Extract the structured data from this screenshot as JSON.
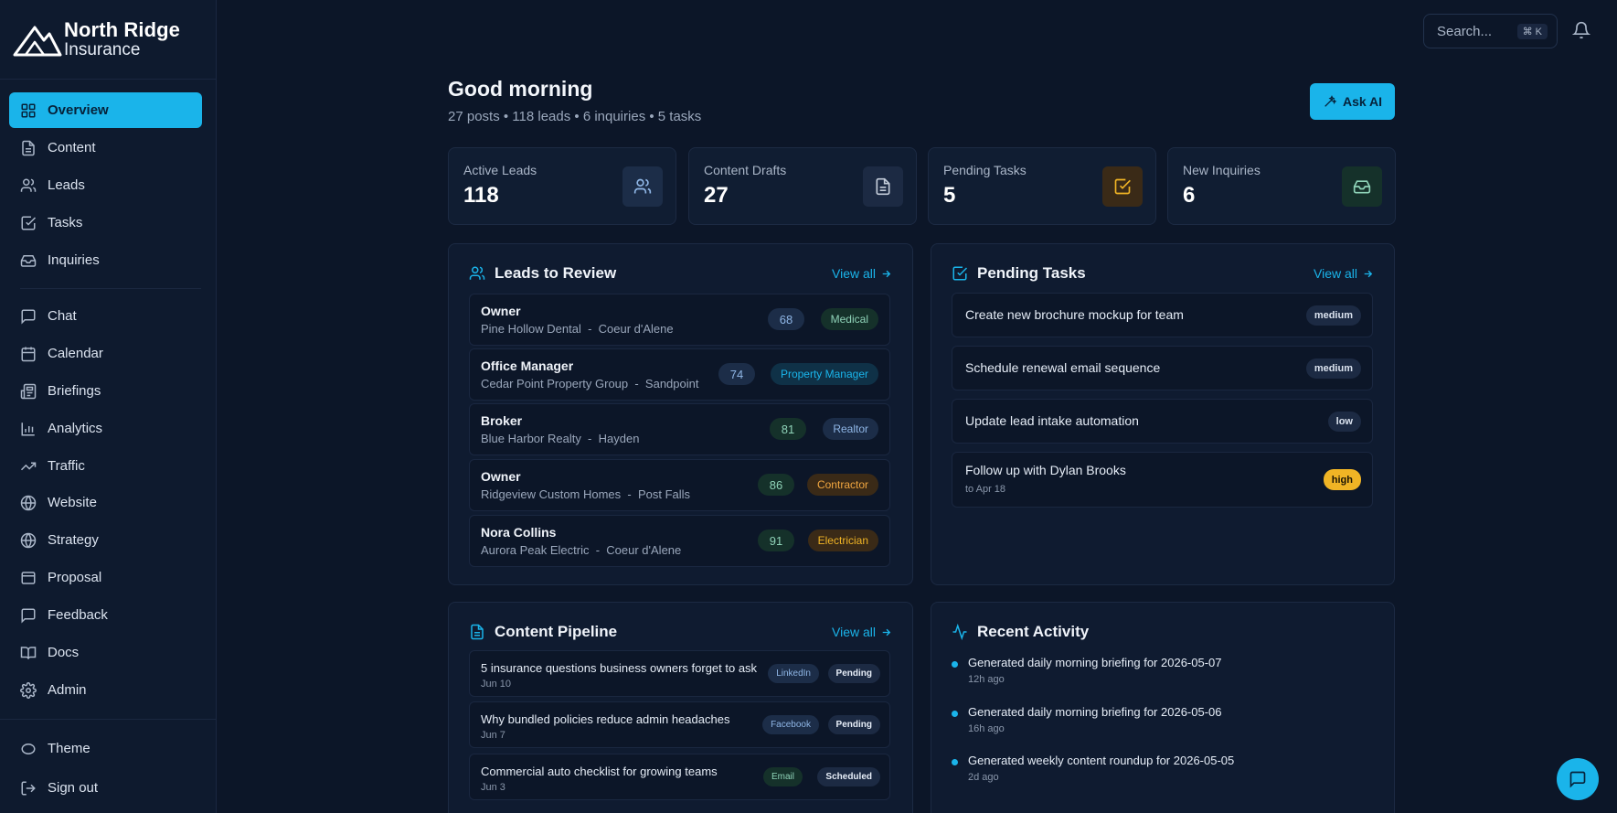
{
  "brand": {
    "name": "North Ridge",
    "sub": "Insurance"
  },
  "nav": {
    "main": [
      {
        "label": "Overview",
        "icon": "grid-icon"
      },
      {
        "label": "Content",
        "icon": "document-icon"
      },
      {
        "label": "Leads",
        "icon": "users-icon"
      },
      {
        "label": "Tasks",
        "icon": "check-square-icon"
      },
      {
        "label": "Inquiries",
        "icon": "inbox-icon"
      }
    ],
    "secondary": [
      {
        "label": "Chat",
        "icon": "chat-icon"
      },
      {
        "label": "Calendar",
        "icon": "calendar-icon"
      },
      {
        "label": "Briefings",
        "icon": "newspaper-icon"
      },
      {
        "label": "Analytics",
        "icon": "bar-chart-icon"
      },
      {
        "label": "Traffic",
        "icon": "trending-up-icon"
      },
      {
        "label": "Website",
        "icon": "globe-icon"
      },
      {
        "label": "Strategy",
        "icon": "globe-icon"
      },
      {
        "label": "Proposal",
        "icon": "window-icon"
      },
      {
        "label": "Feedback",
        "icon": "message-square-icon"
      },
      {
        "label": "Docs",
        "icon": "book-icon"
      },
      {
        "label": "Admin",
        "icon": "gear-icon"
      }
    ],
    "footer": [
      {
        "label": "Theme",
        "icon": "theme-icon"
      },
      {
        "label": "Sign out",
        "icon": "sign-out-icon"
      }
    ]
  },
  "search": {
    "placeholder": "Search...",
    "shortcut": "⌘ K"
  },
  "header": {
    "greeting": "Good morning",
    "summary": "27 posts • 118 leads • 6 inquiries • 5 tasks",
    "ask_ai": "Ask AI"
  },
  "stats": [
    {
      "label": "Active Leads",
      "value": "118",
      "icon": "users-icon",
      "accent": "#4f8fd8"
    },
    {
      "label": "Content Drafts",
      "value": "27",
      "icon": "document-icon",
      "accent": "#9aa7bb"
    },
    {
      "label": "Pending Tasks",
      "value": "5",
      "icon": "check-square-icon",
      "accent": "#f0b425"
    },
    {
      "label": "New Inquiries",
      "value": "6",
      "icon": "inbox-icon",
      "accent": "#3fb08a"
    }
  ],
  "leads": {
    "title": "Leads to Review",
    "view_all": "View all",
    "rows": [
      {
        "title": "Owner",
        "company": "Pine Hollow Dental",
        "location": "Coeur d'Alene",
        "score": "68",
        "tag": "Medical"
      },
      {
        "title": "Office Manager",
        "company": "Cedar Point Property Group",
        "location": "Sandpoint",
        "score": "74",
        "tag": "Property Manager"
      },
      {
        "title": "Broker",
        "company": "Blue Harbor Realty",
        "location": "Hayden",
        "score": "81",
        "tag": "Realtor"
      },
      {
        "title": "Owner",
        "company": "Ridgeview Custom Homes",
        "location": "Post Falls",
        "score": "86",
        "tag": "Contractor"
      },
      {
        "title": "Nora Collins",
        "company": "Aurora Peak Electric",
        "location": "Coeur d'Alene",
        "score": "91",
        "tag": "Electrician"
      }
    ]
  },
  "tasks": {
    "title": "Pending Tasks",
    "view_all": "View all",
    "rows": [
      {
        "title": "Create new brochure mockup for team",
        "priority": "medium"
      },
      {
        "title": "Schedule renewal email sequence",
        "priority": "medium"
      },
      {
        "title": "Update lead intake automation",
        "priority": "low"
      },
      {
        "title": "Follow up with Dylan Brooks",
        "due": "to Apr 18",
        "priority": "high"
      }
    ]
  },
  "content": {
    "title": "Content Pipeline",
    "view_all": "View all",
    "rows": [
      {
        "title": "5 insurance questions business owners forget to ask",
        "date": "Jun 10",
        "channel": "LinkedIn",
        "status": "Pending"
      },
      {
        "title": "Why bundled policies reduce admin headaches",
        "date": "Jun 7",
        "channel": "Facebook",
        "status": "Pending"
      },
      {
        "title": "Commercial auto checklist for growing teams",
        "date": "Jun 3",
        "channel": "Email",
        "status": "Scheduled"
      }
    ]
  },
  "activity": {
    "title": "Recent Activity",
    "items": [
      {
        "text": "Generated daily morning briefing for 2026-05-07",
        "time": "12h ago"
      },
      {
        "text": "Generated daily morning briefing for 2026-05-06",
        "time": "16h ago"
      },
      {
        "text": "Generated weekly content roundup for 2026-05-05",
        "time": "2d ago"
      }
    ]
  },
  "colors": {
    "accent": "#1ab4ea",
    "background": "#0c1628",
    "high_priority": "#f0b425"
  }
}
